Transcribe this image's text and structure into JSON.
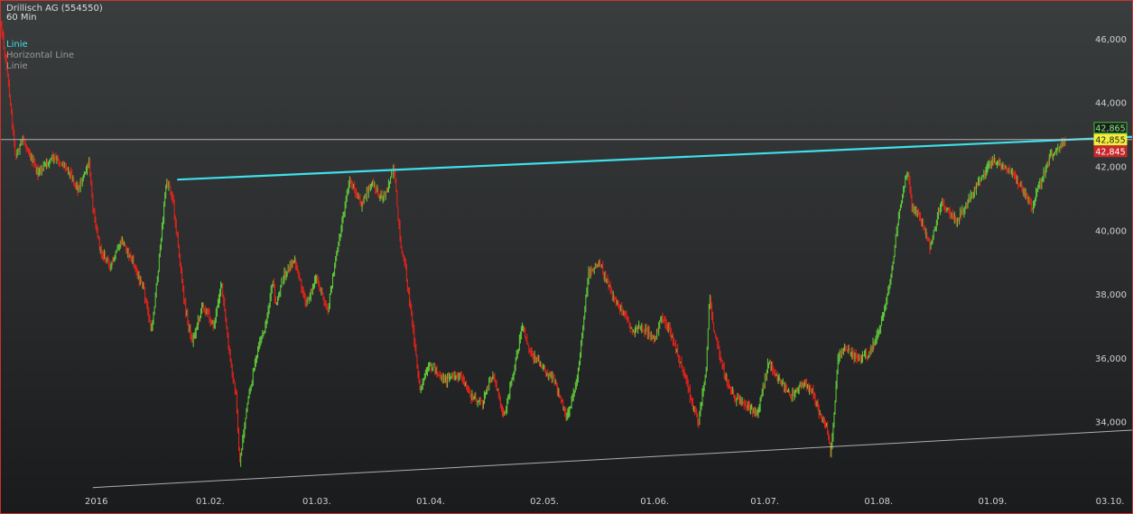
{
  "window": {
    "title": "Drillisch AG (554550)",
    "interval": "60 Min"
  },
  "legend": [
    {
      "label": "Linie",
      "color": "#3fe0ea"
    },
    {
      "label": "Horizontal Line",
      "color": "#9a9a9a"
    },
    {
      "label": "Linie",
      "color": "#9a9a9a"
    }
  ],
  "price_boxes": [
    {
      "label": "42,865",
      "bg": "#1c1c1c",
      "fg": "#7ef07e",
      "border": "#3bbf3b"
    },
    {
      "label": "42,855",
      "bg": "#f2ef3a",
      "fg": "#222222",
      "border": "#f2ef3a"
    },
    {
      "label": "42,845",
      "bg": "#c8282a",
      "fg": "#ffffff",
      "border": "#c8282a"
    }
  ],
  "colors": {
    "up": "#5ec43a",
    "down": "#e0231b",
    "trendline": "#3fe0ea",
    "support": "#c8c8c8",
    "horizontal": "#c8c8c8",
    "axis_text": "#cfcfcf"
  },
  "chart_data": {
    "type": "line",
    "title": "Drillisch AG (554550)",
    "subtitle": "60 Min",
    "xlabel": "",
    "ylabel": "",
    "grid": false,
    "legend_position": "top-left",
    "y_ticks": [
      "34,000",
      "36,000",
      "38,000",
      "40,000",
      "42,000",
      "44,000",
      "46,000"
    ],
    "ylim": [
      31.8,
      47.2
    ],
    "x_ticks": [
      {
        "label": "2016",
        "date": "2016-01-01"
      },
      {
        "label": "01.02.",
        "date": "2016-02-01"
      },
      {
        "label": "01.03.",
        "date": "2016-03-01"
      },
      {
        "label": "01.04.",
        "date": "2016-04-01"
      },
      {
        "label": "02.05.",
        "date": "2016-05-02"
      },
      {
        "label": "01.06.",
        "date": "2016-06-01"
      },
      {
        "label": "01.07.",
        "date": "2016-07-01"
      },
      {
        "label": "01.08.",
        "date": "2016-08-01"
      },
      {
        "label": "01.09.",
        "date": "2016-09-01"
      },
      {
        "label": "03.10.",
        "date": "2016-10-03"
      }
    ],
    "xlim": [
      "2015-12-06",
      "2016-10-09"
    ],
    "series": [
      {
        "name": "Linie",
        "dates": [
          "2015-12-06",
          "2015-12-08",
          "2015-12-10",
          "2015-12-12",
          "2015-12-16",
          "2015-12-20",
          "2015-12-24",
          "2015-12-27",
          "2015-12-30",
          "2015-12-31",
          "2016-01-02",
          "2016-01-05",
          "2016-01-08",
          "2016-01-11",
          "2016-01-14",
          "2016-01-16",
          "2016-01-18",
          "2016-01-20",
          "2016-01-21",
          "2016-01-22",
          "2016-01-25",
          "2016-01-27",
          "2016-01-30",
          "2016-02-02",
          "2016-02-04",
          "2016-02-06",
          "2016-02-08",
          "2016-02-09",
          "2016-02-11",
          "2016-02-14",
          "2016-02-16",
          "2016-02-18",
          "2016-02-19",
          "2016-02-21",
          "2016-02-24",
          "2016-02-27",
          "2016-03-01",
          "2016-03-04",
          "2016-03-07",
          "2016-03-10",
          "2016-03-13",
          "2016-03-16",
          "2016-03-19",
          "2016-03-22",
          "2016-03-24",
          "2016-03-25",
          "2016-03-27",
          "2016-03-29",
          "2016-04-01",
          "2016-04-05",
          "2016-04-09",
          "2016-04-12",
          "2016-04-15",
          "2016-04-18",
          "2016-04-21",
          "2016-04-24",
          "2016-04-26",
          "2016-04-28",
          "2016-05-02",
          "2016-05-05",
          "2016-05-08",
          "2016-05-11",
          "2016-05-14",
          "2016-05-17",
          "2016-05-21",
          "2016-05-24",
          "2016-05-26",
          "2016-05-28",
          "2016-06-01",
          "2016-06-03",
          "2016-06-05",
          "2016-06-07",
          "2016-06-09",
          "2016-06-11",
          "2016-06-13",
          "2016-06-15",
          "2016-06-16",
          "2016-06-17",
          "2016-06-20",
          "2016-06-23",
          "2016-06-26",
          "2016-06-29",
          "2016-07-02",
          "2016-07-05",
          "2016-07-08",
          "2016-07-11",
          "2016-07-14",
          "2016-07-16",
          "2016-07-18",
          "2016-07-19",
          "2016-07-21",
          "2016-07-23",
          "2016-07-26",
          "2016-07-29",
          "2016-08-01",
          "2016-08-04",
          "2016-08-07",
          "2016-08-09",
          "2016-08-10",
          "2016-08-12",
          "2016-08-15",
          "2016-08-18",
          "2016-08-22",
          "2016-08-25",
          "2016-08-28",
          "2016-09-01",
          "2016-09-04",
          "2016-09-07",
          "2016-09-10",
          "2016-09-12",
          "2016-09-13",
          "2016-09-15",
          "2016-09-17",
          "2016-09-19",
          "2016-09-21"
        ],
        "values": [
          46.5,
          44.7,
          42.3,
          42.9,
          41.8,
          42.3,
          42.0,
          41.3,
          42.1,
          40.8,
          39.4,
          38.9,
          39.7,
          39.0,
          38.1,
          36.8,
          39.0,
          41.5,
          41.4,
          40.8,
          37.7,
          36.5,
          37.7,
          37.0,
          38.4,
          36.3,
          34.8,
          32.7,
          34.5,
          36.3,
          37.0,
          38.4,
          37.6,
          38.6,
          39.1,
          37.7,
          38.5,
          37.5,
          39.7,
          41.6,
          40.8,
          41.5,
          41.0,
          41.9,
          39.4,
          38.9,
          37.2,
          35.0,
          35.8,
          35.3,
          35.5,
          34.8,
          34.6,
          35.5,
          34.2,
          35.8,
          37.0,
          36.2,
          35.7,
          35.2,
          34.1,
          35.4,
          38.7,
          39.0,
          37.8,
          37.4,
          36.8,
          37.0,
          36.6,
          37.3,
          36.9,
          36.2,
          35.5,
          34.7,
          34.0,
          35.7,
          37.9,
          37.0,
          35.5,
          34.7,
          34.5,
          34.3,
          35.9,
          35.3,
          34.8,
          35.2,
          35.0,
          34.2,
          33.8,
          33.0,
          36.1,
          36.3,
          36.0,
          36.1,
          36.8,
          38.3,
          40.9,
          41.9,
          40.7,
          40.5,
          39.5,
          40.9,
          40.3,
          40.8,
          41.5,
          42.2,
          42.0,
          41.7,
          41.1,
          40.7,
          41.2,
          41.8,
          42.4,
          42.6,
          42.855
        ]
      }
    ],
    "annotations": [
      {
        "name": "Linie",
        "kind": "trendline",
        "from": {
          "date": "2016-01-23",
          "value": 41.6
        },
        "to": {
          "date": "2016-10-09",
          "value": 42.94
        }
      },
      {
        "name": "Horizontal Line",
        "kind": "horizontal",
        "value": 42.855
      },
      {
        "name": "Linie",
        "kind": "trendline",
        "from": {
          "date": "2015-12-31",
          "value": 31.95
        },
        "to": {
          "date": "2016-10-09",
          "value": 33.75
        }
      }
    ]
  }
}
